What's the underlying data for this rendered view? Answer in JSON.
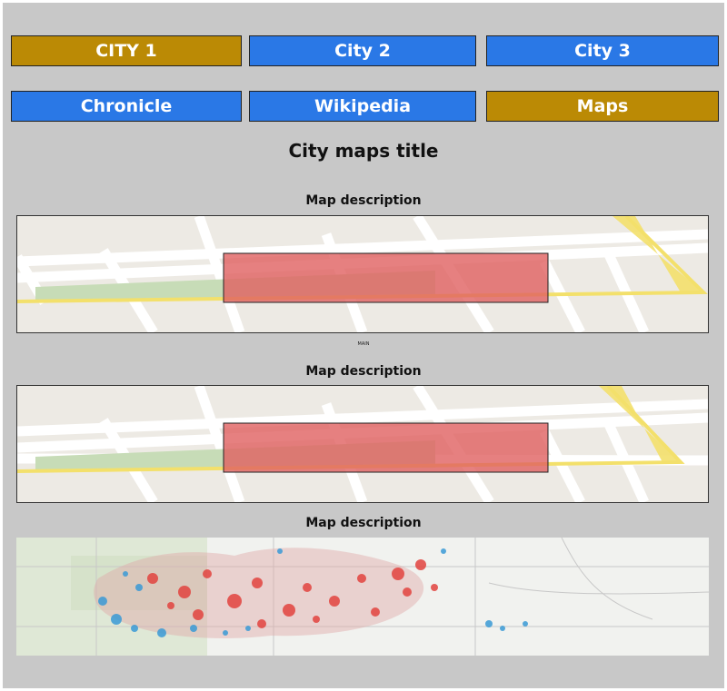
{
  "nav_row_1": [
    {
      "label": "CITY 1",
      "state": "active"
    },
    {
      "label": "City 2",
      "state": "inactive"
    },
    {
      "label": "City 3",
      "state": "inactive"
    }
  ],
  "nav_row_2": [
    {
      "label": "Chronicle",
      "state": "inactive"
    },
    {
      "label": "Wikipedia",
      "state": "inactive"
    },
    {
      "label": "Maps",
      "state": "active"
    }
  ],
  "page_title": "City maps title",
  "maps": [
    {
      "description": "Map description",
      "sublabel": "MAIN"
    },
    {
      "description": "Map description"
    },
    {
      "description": "Map description"
    }
  ],
  "colors": {
    "active": "#bb8a05",
    "inactive": "#2a78e6",
    "panel": "#c8c8c8",
    "map_bg": "#edeae4"
  }
}
